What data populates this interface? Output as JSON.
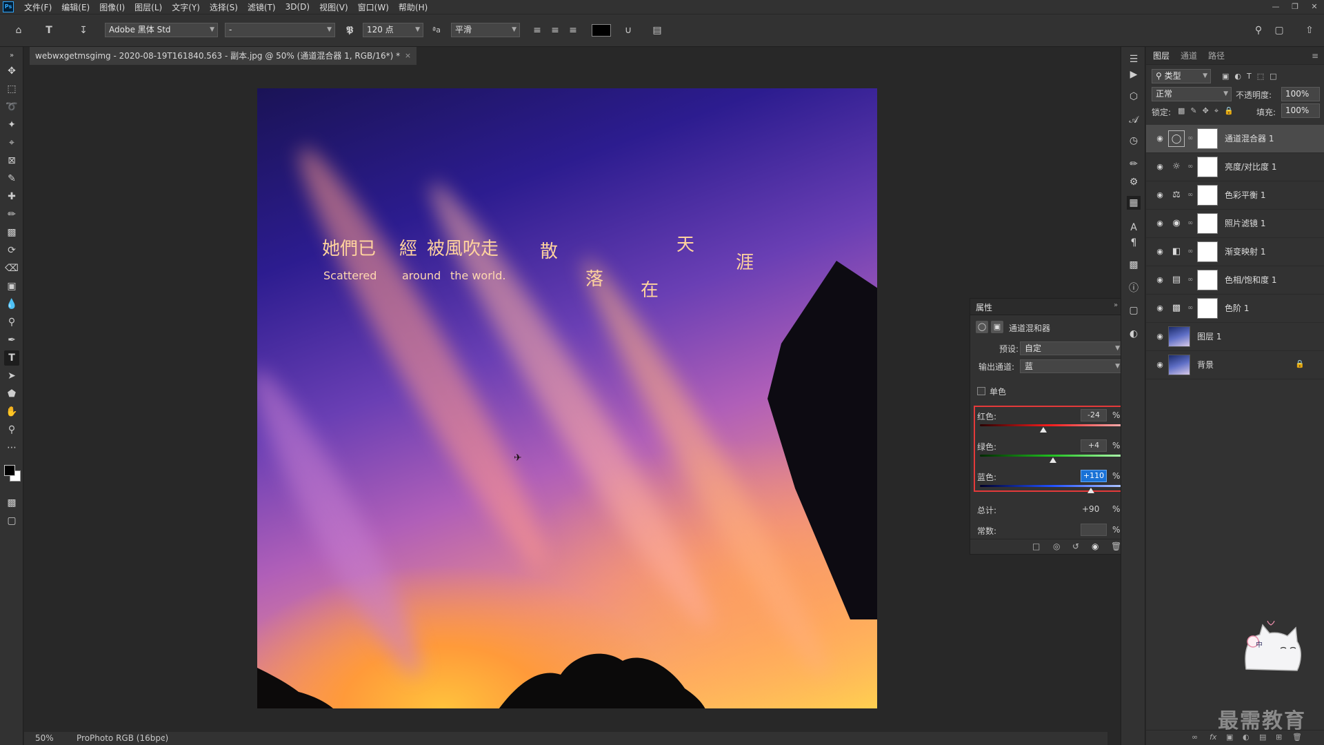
{
  "app": {
    "logo": "Ps"
  },
  "menu": [
    "文件(F)",
    "编辑(E)",
    "图像(I)",
    "图层(L)",
    "文字(Y)",
    "选择(S)",
    "滤镜(T)",
    "3D(D)",
    "视图(V)",
    "窗口(W)",
    "帮助(H)"
  ],
  "options": {
    "font_family": "Adobe 黑体 Std",
    "font_style": "-",
    "font_size": "120 点",
    "antialias": "平滑",
    "text_color": "#000000"
  },
  "document": {
    "tab_title": "webwxgetmsgimg - 2020-08-19T161840.563 - 副本.jpg @ 50% (通道混合器 1, RGB/16*) *",
    "poem": {
      "line1a": "她們已",
      "line1b": "經",
      "line1c": "被風吹走",
      "char_san": "散",
      "char_luo": "落",
      "char_zai": "在",
      "char_tian": "天",
      "char_ya": "涯",
      "en1": "Scattered",
      "en2": "around",
      "en3": "the world."
    }
  },
  "status": {
    "zoom": "50%",
    "profile": "ProPhoto RGB (16bpc)"
  },
  "properties": {
    "title": "属性",
    "adjustment_name": "通道混和器",
    "preset_label": "预设:",
    "preset_value": "自定",
    "output_label": "输出通道:",
    "output_value": "蓝",
    "mono_label": "单色",
    "channels": [
      {
        "label": "红色:",
        "value": "-24",
        "unit": "%",
        "level": 0.44
      },
      {
        "label": "绿色:",
        "value": "+4",
        "unit": "%",
        "level": 0.51
      },
      {
        "label": "蓝色:",
        "value": "+110",
        "unit": "%",
        "level": 0.775
      }
    ],
    "total_label": "总计:",
    "total_value": "+90",
    "total_unit": "%",
    "constant_label": "常数:",
    "constant_unit": "%"
  },
  "layers_panel": {
    "tabs": [
      "图层",
      "通道",
      "路径"
    ],
    "filter_label": "类型",
    "blend_mode": "正常",
    "opacity_label": "不透明度:",
    "opacity_value": "100%",
    "lock_label": "锁定:",
    "fill_label": "填充:",
    "fill_value": "100%",
    "layers": [
      {
        "name": "通道混合器 1",
        "icon": "channel-mixer-icon",
        "selected": true
      },
      {
        "name": "亮度/对比度 1",
        "icon": "brightness-icon"
      },
      {
        "name": "色彩平衡 1",
        "icon": "color-balance-icon"
      },
      {
        "name": "照片滤镜 1",
        "icon": "photo-filter-icon"
      },
      {
        "name": "渐变映射 1",
        "icon": "gradient-map-icon"
      },
      {
        "name": "色相/饱和度 1",
        "icon": "hue-saturation-icon"
      },
      {
        "name": "色阶 1",
        "icon": "levels-icon"
      },
      {
        "name": "图层 1",
        "icon": "image-thumb"
      },
      {
        "name": "背景",
        "icon": "image-thumb",
        "locked": true
      }
    ]
  },
  "watermark": {
    "text": "最需教育",
    "mascot_label": "中"
  }
}
